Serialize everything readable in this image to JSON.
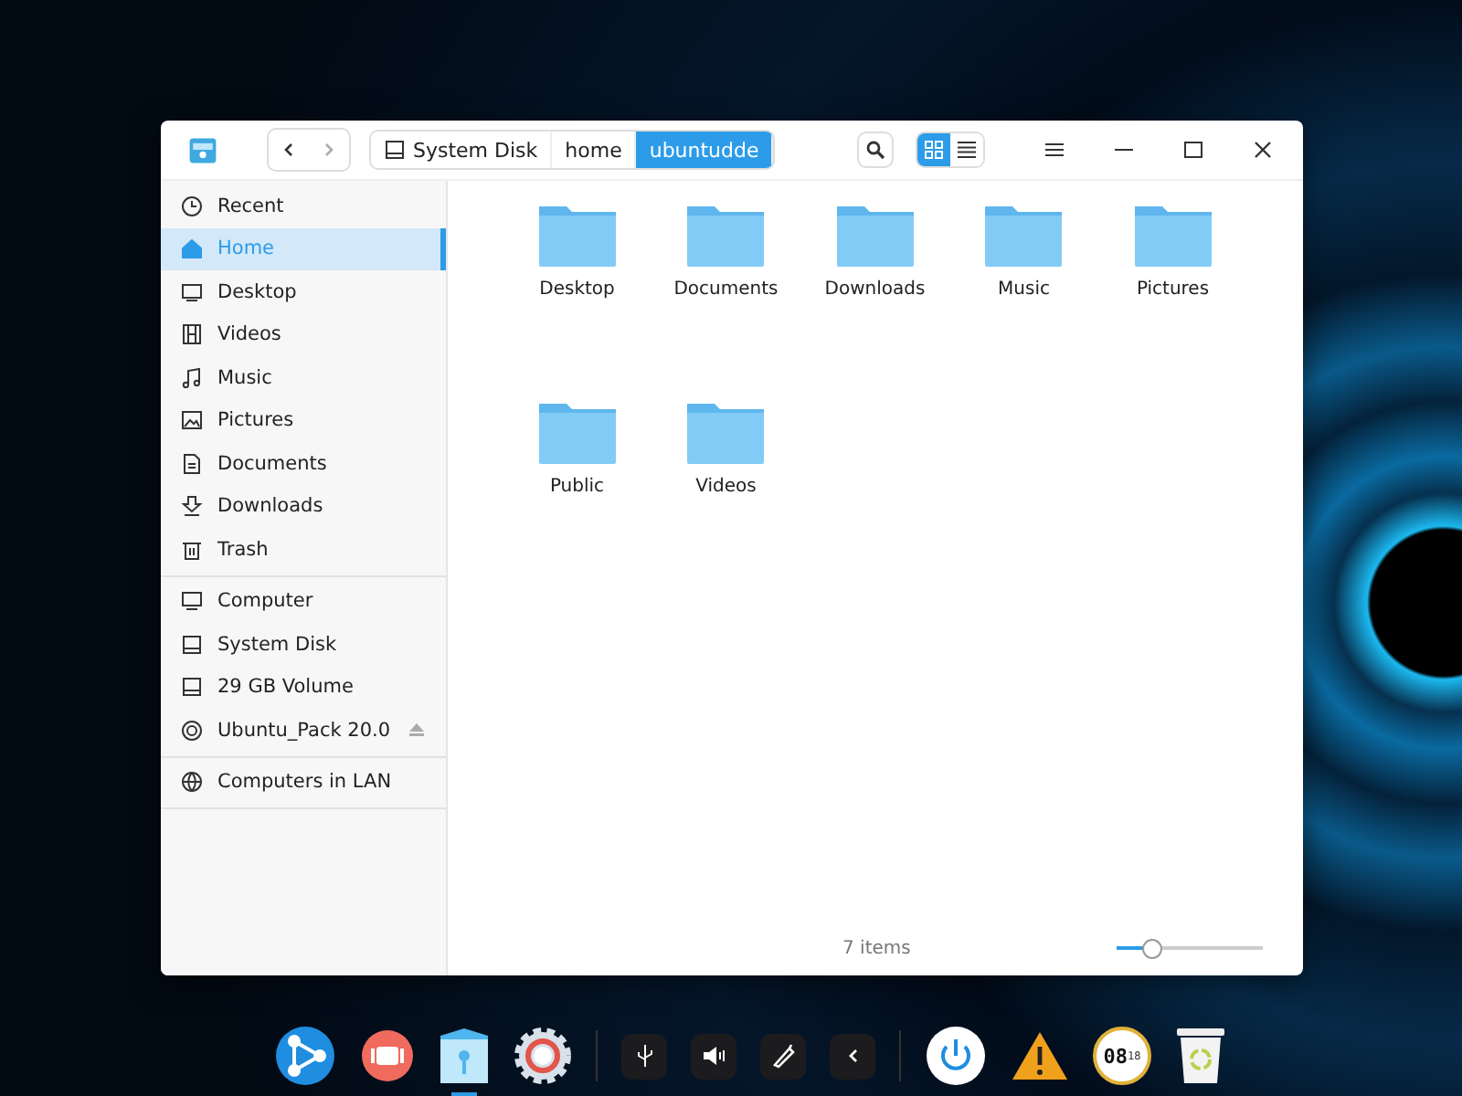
{
  "window": {
    "breadcrumbs": [
      {
        "label": "System Disk",
        "kind": "disk",
        "selected": false
      },
      {
        "label": "home",
        "kind": "plain",
        "selected": false
      },
      {
        "label": "ubuntudde",
        "kind": "plain",
        "selected": true
      }
    ],
    "views": [
      {
        "kind": "icons",
        "selected": true
      },
      {
        "kind": "list",
        "selected": false
      }
    ]
  },
  "sidebar": {
    "groups": [
      [
        {
          "label": "Recent",
          "kind": "recent",
          "selected": false
        },
        {
          "label": "Home",
          "kind": "home",
          "selected": true
        },
        {
          "label": "Desktop",
          "kind": "desktop",
          "selected": false
        },
        {
          "label": "Videos",
          "kind": "videos",
          "selected": false
        },
        {
          "label": "Music",
          "kind": "music",
          "selected": false
        },
        {
          "label": "Pictures",
          "kind": "pictures",
          "selected": false
        },
        {
          "label": "Documents",
          "kind": "documents",
          "selected": false
        },
        {
          "label": "Downloads",
          "kind": "downloads",
          "selected": false
        },
        {
          "label": "Trash",
          "kind": "trash",
          "selected": false
        }
      ],
      [
        {
          "label": "Computer",
          "kind": "computer",
          "selected": false
        },
        {
          "label": "System Disk",
          "kind": "disk",
          "selected": false
        },
        {
          "label": "29 GB Volume",
          "kind": "disk",
          "selected": false
        },
        {
          "label": "Ubuntu_Pack 20.0",
          "kind": "disc",
          "selected": false,
          "ejectable": true
        }
      ],
      [
        {
          "label": "Computers in LAN",
          "kind": "network",
          "selected": false
        }
      ]
    ]
  },
  "folders": [
    "Desktop",
    "Documents",
    "Downloads",
    "Music",
    "Pictures",
    "Public",
    "Videos"
  ],
  "status_bar": {
    "count": "7 items",
    "zoom": {
      "level": 0.25
    }
  },
  "dock": {
    "items": [
      {
        "kind": "share"
      },
      {
        "kind": "media"
      },
      {
        "kind": "files"
      },
      {
        "kind": "settings"
      },
      {
        "kind": "divider"
      },
      {
        "kind": "usb"
      },
      {
        "kind": "volume"
      },
      {
        "kind": "pen"
      },
      {
        "kind": "collapse"
      },
      {
        "kind": "divider"
      },
      {
        "kind": "power"
      },
      {
        "kind": "warning"
      },
      {
        "kind": "clock",
        "hour": "08",
        "minute": "18"
      },
      {
        "kind": "trash"
      }
    ]
  }
}
